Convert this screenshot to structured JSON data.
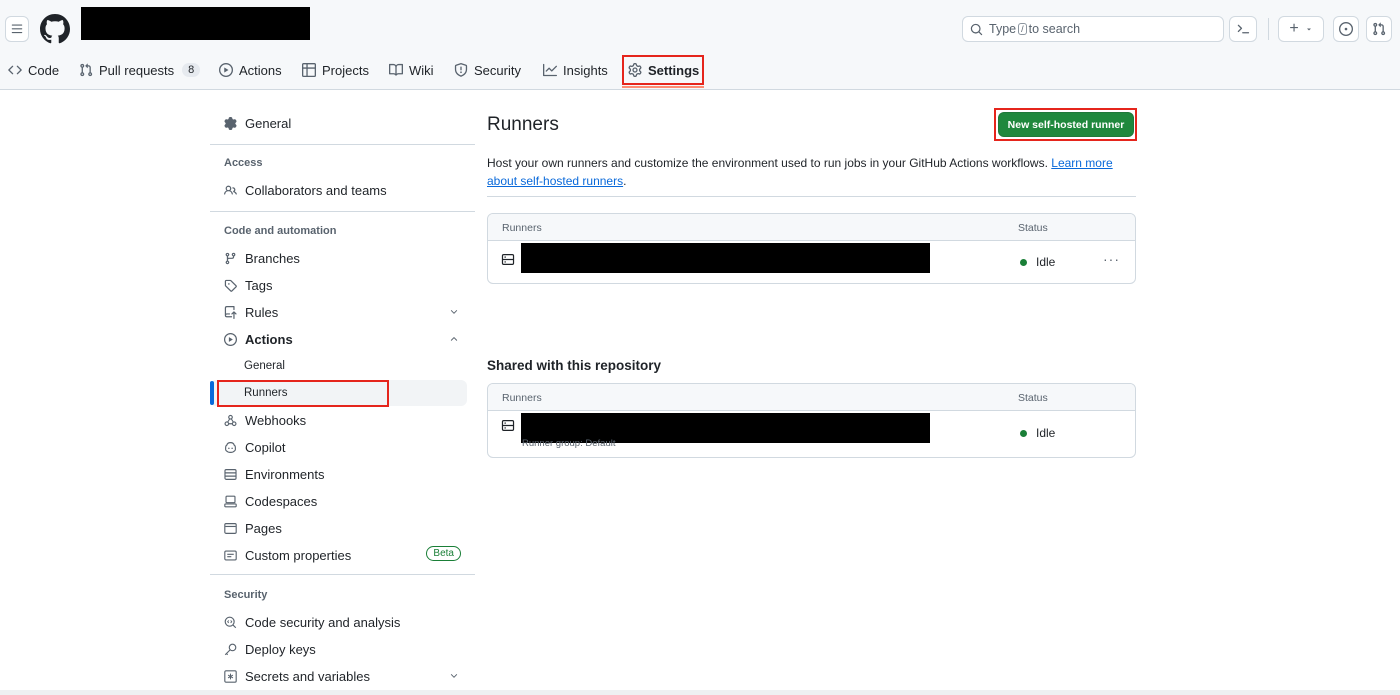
{
  "header": {
    "search_placeholder_pre": "Type",
    "search_key": "/",
    "search_placeholder_post": "to search",
    "plus_label": "+"
  },
  "nav": {
    "tabs": [
      {
        "label": "Code",
        "icon": "code-icon"
      },
      {
        "label": "Pull requests",
        "icon": "git-pull-request-icon",
        "count": "8"
      },
      {
        "label": "Actions",
        "icon": "play-icon"
      },
      {
        "label": "Projects",
        "icon": "table-icon"
      },
      {
        "label": "Wiki",
        "icon": "book-icon"
      },
      {
        "label": "Security",
        "icon": "shield-icon"
      },
      {
        "label": "Insights",
        "icon": "graph-icon"
      },
      {
        "label": "Settings",
        "icon": "gear-icon",
        "selected": true
      }
    ]
  },
  "sidebar": {
    "general": "General",
    "groups": {
      "access": "Access",
      "code_automation": "Code and automation",
      "security": "Security"
    },
    "items": {
      "collaborators": "Collaborators and teams",
      "branches": "Branches",
      "tags": "Tags",
      "rules": "Rules",
      "actions": "Actions",
      "actions_general": "General",
      "actions_runners": "Runners",
      "webhooks": "Webhooks",
      "copilot": "Copilot",
      "environments": "Environments",
      "codespaces": "Codespaces",
      "pages": "Pages",
      "custom_properties": "Custom properties",
      "beta": "Beta",
      "code_security": "Code security and analysis",
      "deploy_keys": "Deploy keys",
      "secrets": "Secrets and variables"
    }
  },
  "main": {
    "title": "Runners",
    "new_runner_button": "New self-hosted runner",
    "description": "Host your own runners and customize the environment used to run jobs in your GitHub Actions workflows.",
    "learn_more": "Learn more about self-hosted runners",
    "description_end": ".",
    "table": {
      "col_runners": "Runners",
      "col_status": "Status",
      "rows": [
        {
          "status": "Idle"
        }
      ]
    },
    "shared": {
      "title": "Shared with this repository",
      "col_runners": "Runners",
      "col_status": "Status",
      "rows": [
        {
          "group": "Runner group: Default",
          "status": "Idle"
        }
      ]
    }
  },
  "colors": {
    "accent_green": "#1f883d",
    "status_green": "#1a7f37",
    "link_blue": "#0969da",
    "highlight_red": "#e5251c"
  }
}
